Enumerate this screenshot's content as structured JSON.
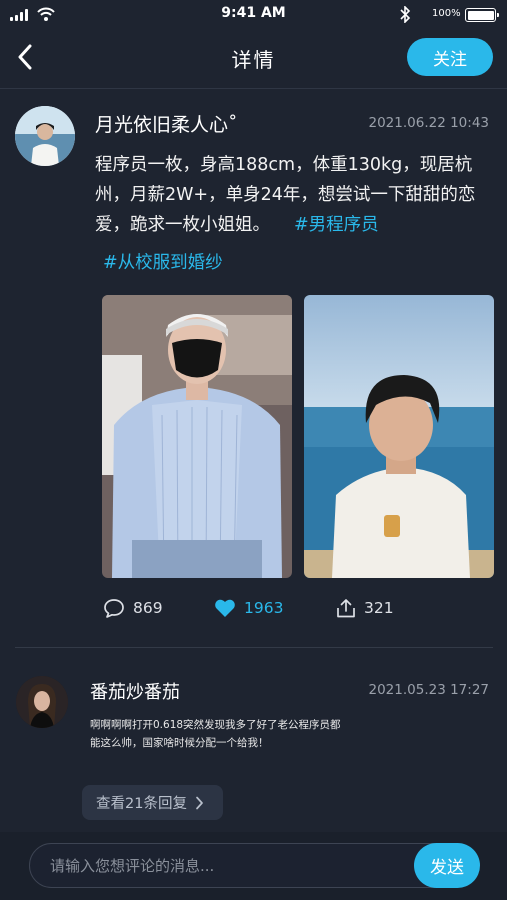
{
  "status_bar": {
    "time": "9:41 AM",
    "battery_text": "100%",
    "icons": [
      "signal-icon",
      "wifi-icon",
      "bluetooth-icon",
      "battery-icon"
    ]
  },
  "header": {
    "title": "详情",
    "follow_label": "关注",
    "back_icon": "chevron-left-icon"
  },
  "post": {
    "author": "月光依旧柔人心˚",
    "date": "2021.06.22 10:43",
    "text": "程序员一枚，身高188cm，体重130kg，现居杭州，月薪2W+，单身24年，想尝试一下甜甜的恋爱，跪求一枚小姐姐。",
    "tag1": "#男程序员",
    "tag2": "#从校服到婚纱",
    "stats": {
      "comments": "869",
      "likes": "1963",
      "shares": "321"
    },
    "accent_color": "#2ab8ea"
  },
  "comment": {
    "author": "番茄炒番茄",
    "date": "2021.05.23 17:27",
    "text": "啊啊啊啊打开0.618突然发现我多了好了老公程序员都能这么帅，国家啥时候分配一个给我！",
    "replies_label": "查看21条回复"
  },
  "input_bar": {
    "placeholder": "请输入您想评论的消息...",
    "send_label": "发送"
  }
}
